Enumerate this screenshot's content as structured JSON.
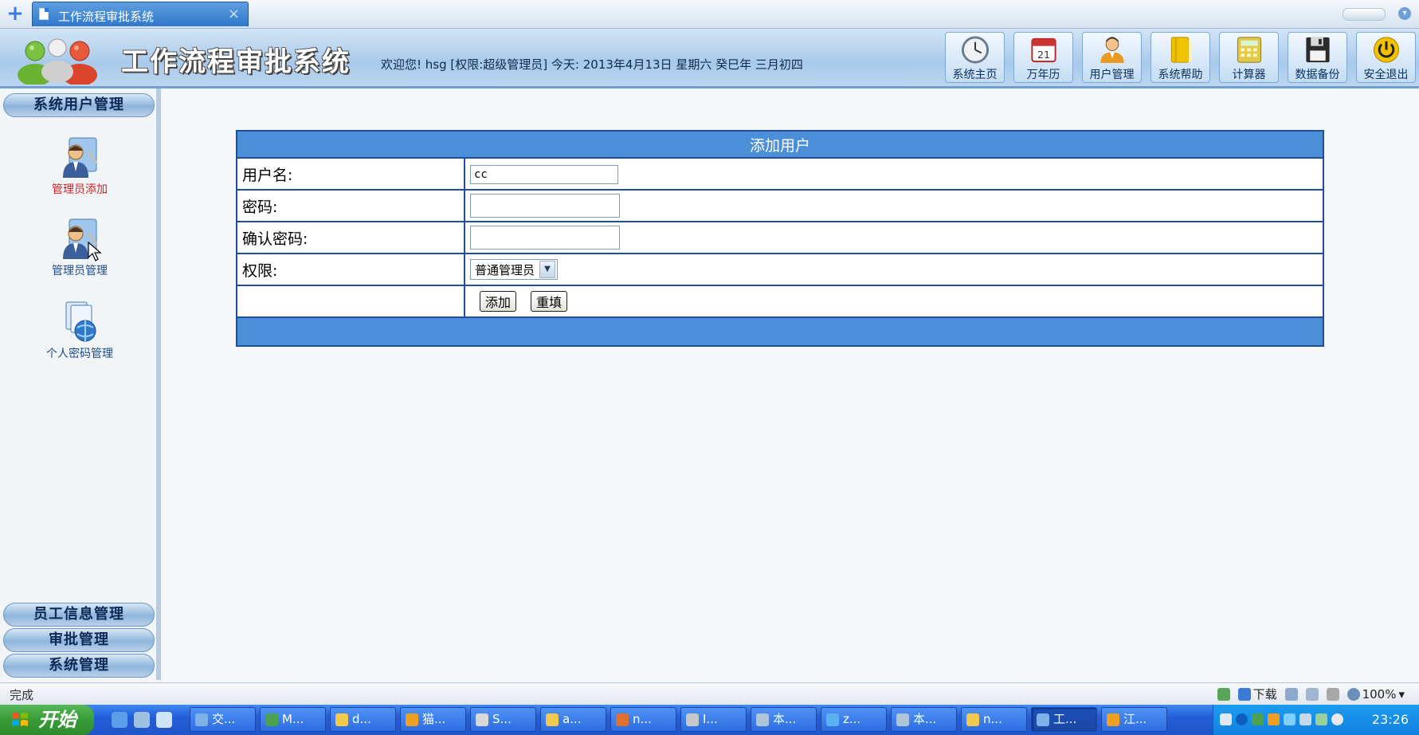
{
  "browser": {
    "tab_title": "工作流程审批系统",
    "tab_close": "×",
    "new_tab": "+",
    "dropdown": "▾",
    "status_text": "完成",
    "download_label": "下载",
    "zoom": "100%"
  },
  "header": {
    "app_title": "工作流程审批系统",
    "welcome": "欢迎您! hsg [权限:超级管理员] 今天: 2013年4月13日 星期六 癸巳年 三月初四",
    "nav": [
      {
        "label": "系统主页",
        "icon": "clock-icon"
      },
      {
        "label": "万年历",
        "icon": "calendar-icon"
      },
      {
        "label": "用户管理",
        "icon": "user-icon"
      },
      {
        "label": "系统帮助",
        "icon": "help-notebook-icon"
      },
      {
        "label": "计算器",
        "icon": "calculator-icon"
      },
      {
        "label": "数据备份",
        "icon": "floppy-disk-icon"
      },
      {
        "label": "安全退出",
        "icon": "power-icon"
      }
    ],
    "calendar_day": "21"
  },
  "sidebar": {
    "top_header": "系统用户管理",
    "items": [
      {
        "label": "管理员添加",
        "active": true
      },
      {
        "label": "管理员管理",
        "active": false
      },
      {
        "label": "个人密码管理",
        "active": false
      }
    ],
    "bottom_headers": [
      "员工信息管理",
      "审批管理",
      "系统管理"
    ]
  },
  "form": {
    "caption": "添加用户",
    "username_label": "用户名:",
    "username_value": "cc",
    "password_label": "密码:",
    "password_value": "",
    "confirm_label": "确认密码:",
    "confirm_value": "",
    "role_label": "权限:",
    "role_selected": "普通管理员",
    "submit_label": "添加",
    "reset_label": "重填"
  },
  "taskbar": {
    "start_label": "开始",
    "tasks": [
      "交...",
      "M...",
      "d...",
      "猫...",
      "S...",
      "a...",
      "n...",
      "I...",
      "本...",
      "z...",
      "本...",
      "n...",
      "工...",
      "江..."
    ],
    "active_task_index": 12,
    "clock": "23:26"
  },
  "colors": {
    "accent": "#4a8fd8",
    "table_border": "#1d4f9a",
    "active_sidebar_label": "#d42020",
    "taskbar": "#245edb",
    "start_green": "#379c37"
  }
}
